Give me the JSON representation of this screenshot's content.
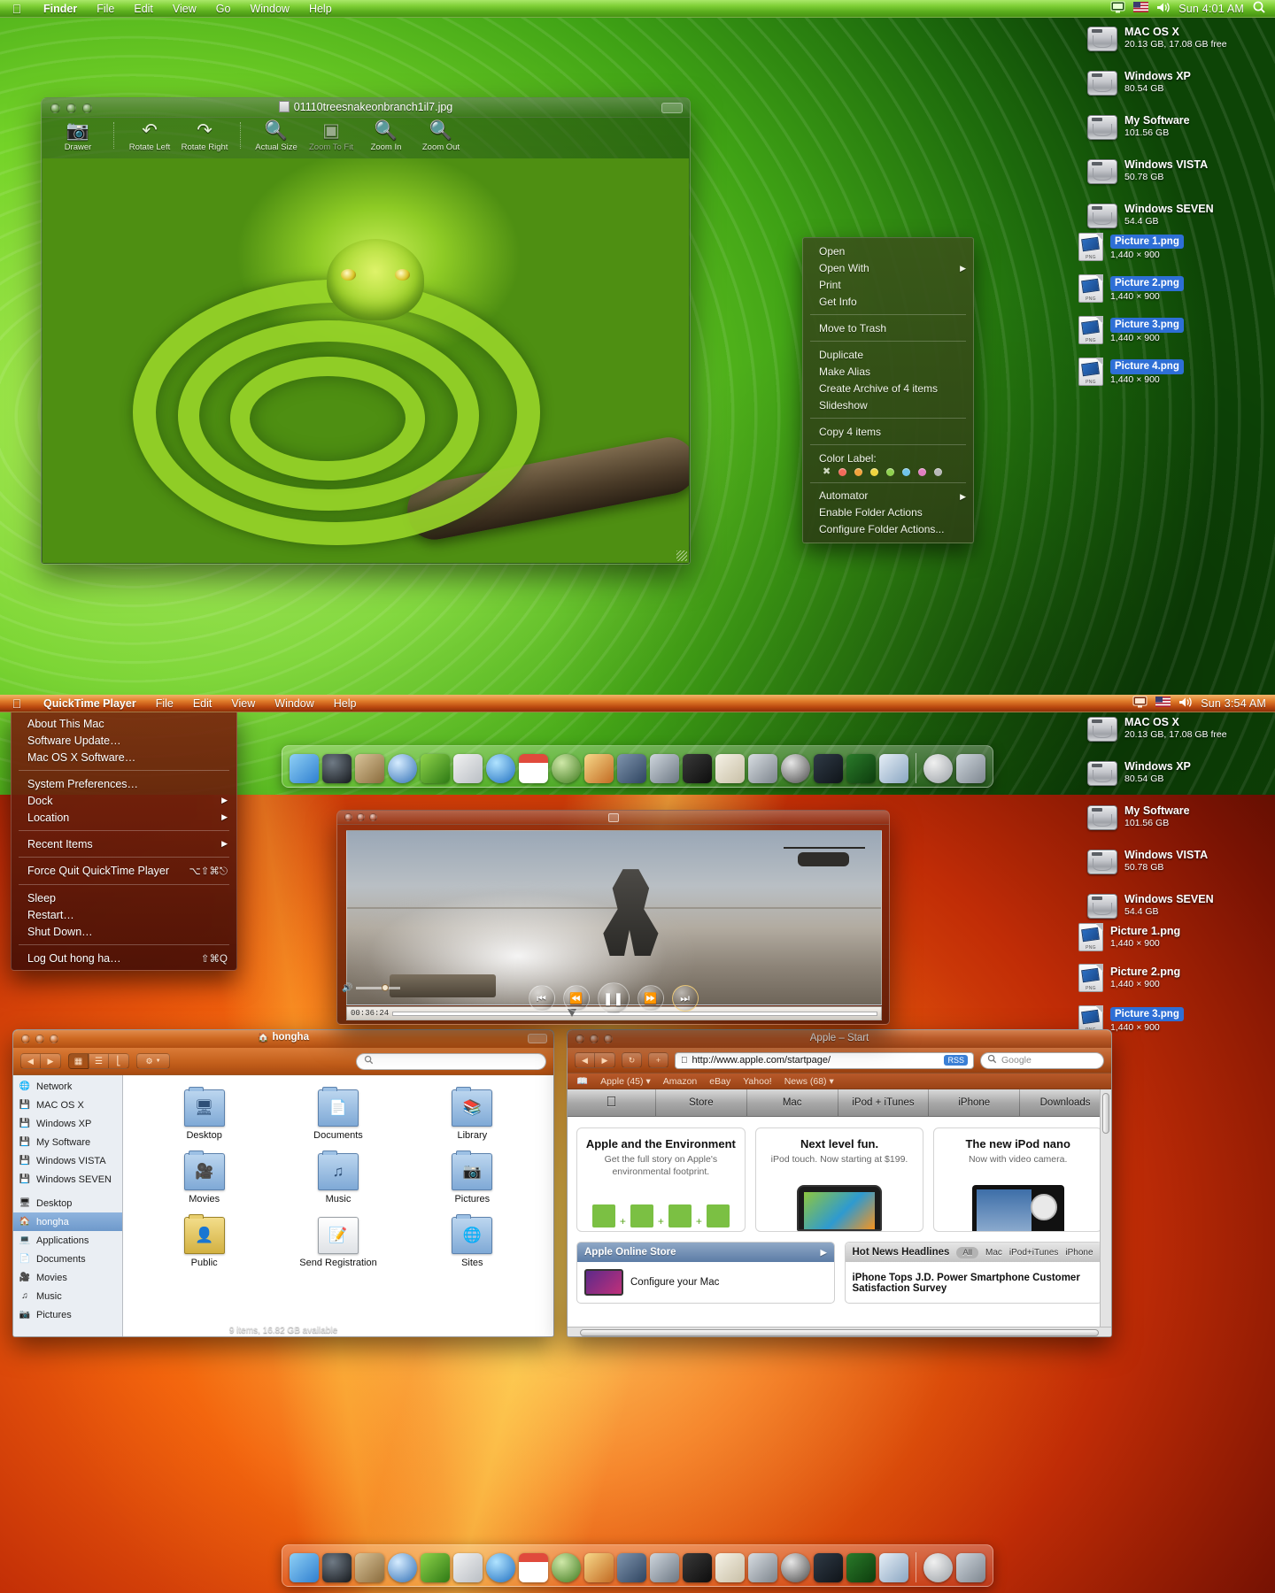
{
  "top_screen": {
    "menubar": {
      "apple_icon": "apple-logo",
      "items": [
        "Finder",
        "File",
        "Edit",
        "View",
        "Go",
        "Window",
        "Help"
      ],
      "active_app": "Finder",
      "extras": [
        "display-icon",
        "us-flag-icon",
        "volume-icon"
      ],
      "clock": "Sun 4:01 AM",
      "spotlight_icon": "magnifier-icon"
    },
    "desktop_drives": [
      {
        "name": "MAC OS X",
        "info": "20.13 GB, 17.08 GB free"
      },
      {
        "name": "Windows XP",
        "info": "80.54 GB"
      },
      {
        "name": "My Software",
        "info": "101.56 GB"
      },
      {
        "name": "Windows VISTA",
        "info": "50.78 GB"
      },
      {
        "name": "Windows SEVEN",
        "info": "54.4 GB"
      }
    ],
    "desktop_pictures": [
      {
        "name": "Picture 1.png",
        "info": "1,440 × 900"
      },
      {
        "name": "Picture 2.png",
        "info": "1,440 × 900"
      },
      {
        "name": "Picture 3.png",
        "info": "1,440 × 900"
      },
      {
        "name": "Picture 4.png",
        "info": "1,440 × 900"
      }
    ],
    "preview_window": {
      "title": "01110treesnakeonbranch1il7.jpg",
      "toolbar": [
        {
          "label": "Drawer",
          "icon": "drawer-icon",
          "enabled": true
        },
        {
          "label": "Rotate Left",
          "icon": "rotate-left-icon",
          "enabled": true
        },
        {
          "label": "Rotate Right",
          "icon": "rotate-right-icon",
          "enabled": true
        },
        {
          "label": "Actual Size",
          "icon": "magnifier-actual-icon",
          "enabled": true
        },
        {
          "label": "Zoom To Fit",
          "icon": "zoom-fit-icon",
          "enabled": false
        },
        {
          "label": "Zoom In",
          "icon": "zoom-in-icon",
          "enabled": true
        },
        {
          "label": "Zoom Out",
          "icon": "zoom-out-icon",
          "enabled": true
        }
      ]
    },
    "context_menu": {
      "groups": [
        [
          {
            "label": "Open"
          },
          {
            "label": "Open With",
            "submenu": true
          },
          {
            "label": "Print"
          },
          {
            "label": "Get Info"
          }
        ],
        [
          {
            "label": "Move to Trash"
          }
        ],
        [
          {
            "label": "Duplicate"
          },
          {
            "label": "Make Alias"
          },
          {
            "label": "Create Archive of 4 items"
          },
          {
            "label": "Slideshow"
          }
        ],
        [
          {
            "label": "Copy 4 items"
          }
        ]
      ],
      "color_label": "Color Label:",
      "swatch_colors": [
        "#f26a5a",
        "#f2a23c",
        "#efd53f",
        "#8fd14f",
        "#6fc3e8",
        "#e07ec0",
        "#b7b7b7"
      ],
      "tail": [
        {
          "label": "Automator",
          "submenu": true
        },
        {
          "label": "Enable Folder Actions"
        },
        {
          "label": "Configure Folder Actions..."
        }
      ]
    },
    "dock_icons": [
      "finder-icon",
      "dashboard-icon",
      "address-book-icon",
      "safari-icon",
      "ichat-icon",
      "mail-icon",
      "itunes-icon",
      "ical-icon",
      "time-machine-icon",
      "iphoto-icon",
      "spaces-icon",
      "automator-icon",
      "terminal-icon",
      "font-book-icon",
      "utilities-icon",
      "quicktime-icon",
      "dvd-player-icon",
      "activity-monitor-icon",
      "preview-icon",
      "at-symbol-icon",
      "trash-icon"
    ]
  },
  "bottom_screen": {
    "menubar": {
      "apple_icon": "apple-logo",
      "items": [
        "QuickTime Player",
        "File",
        "Edit",
        "View",
        "Window",
        "Help"
      ],
      "active_app": "QuickTime Player",
      "extras": [
        "display-icon",
        "us-flag-icon",
        "volume-icon"
      ],
      "clock": "Sun 3:54 AM"
    },
    "apple_menu": {
      "groups": [
        [
          {
            "label": "About This Mac"
          },
          {
            "label": "Software Update…"
          },
          {
            "label": "Mac OS X Software…"
          }
        ],
        [
          {
            "label": "System Preferences…"
          },
          {
            "label": "Dock",
            "submenu": true
          },
          {
            "label": "Location",
            "submenu": true
          }
        ],
        [
          {
            "label": "Recent Items",
            "submenu": true
          }
        ],
        [
          {
            "label": "Force Quit QuickTime Player",
            "shortcut": "⌥⇧⌘⎋"
          }
        ],
        [
          {
            "label": "Sleep"
          },
          {
            "label": "Restart…"
          },
          {
            "label": "Shut Down…"
          }
        ],
        [
          {
            "label": "Log Out hong ha…",
            "shortcut": "⇧⌘Q"
          }
        ]
      ]
    },
    "quicktime": {
      "current_time": "00:36:24",
      "controls": [
        "skip-back-icon",
        "rewind-icon",
        "pause-icon",
        "fast-forward-icon",
        "skip-forward-icon"
      ]
    },
    "desktop_drives": [
      {
        "name": "MAC OS X",
        "info": "20.13 GB, 17.08 GB free"
      },
      {
        "name": "Windows XP",
        "info": "80.54 GB"
      },
      {
        "name": "My Software",
        "info": "101.56 GB"
      },
      {
        "name": "Windows VISTA",
        "info": "50.78 GB"
      },
      {
        "name": "Windows SEVEN",
        "info": "54.4 GB"
      }
    ],
    "desktop_pictures": [
      {
        "name": "Picture 1.png",
        "info": "1,440 × 900"
      },
      {
        "name": "Picture 2.png",
        "info": "1,440 × 900"
      },
      {
        "name": "Picture 3.png",
        "info": "1,440 × 900"
      }
    ],
    "finder_window": {
      "title": "hongha",
      "title_icon": "home-icon",
      "search_placeholder": "",
      "search_icon": "search-icon",
      "nav_back_icon": "back-arrow-icon",
      "nav_forward_icon": "forward-arrow-icon",
      "view_icons": [
        "icon-view-icon",
        "list-view-icon",
        "column-view-icon"
      ],
      "action_icon": "gear-icon",
      "sidebar_devices": [
        "Network",
        "MAC OS X",
        "Windows XP",
        "My Software",
        "Windows VISTA",
        "Windows SEVEN"
      ],
      "sidebar_places": [
        "Desktop",
        "hongha",
        "Applications",
        "Documents",
        "Movies",
        "Music",
        "Pictures"
      ],
      "sidebar_selected": "hongha",
      "items": [
        {
          "name": "Desktop",
          "icon": "desktop-folder-icon"
        },
        {
          "name": "Documents",
          "icon": "documents-folder-icon"
        },
        {
          "name": "Library",
          "icon": "library-folder-icon"
        },
        {
          "name": "Movies",
          "icon": "movies-folder-icon"
        },
        {
          "name": "Music",
          "icon": "music-folder-icon"
        },
        {
          "name": "Pictures",
          "icon": "pictures-folder-icon"
        },
        {
          "name": "Public",
          "icon": "public-folder-icon"
        },
        {
          "name": "Send Registration",
          "icon": "registration-doc-icon"
        },
        {
          "name": "Sites",
          "icon": "sites-folder-icon"
        }
      ],
      "status": "9 items, 16.82 GB available"
    },
    "safari_window": {
      "title": "Apple – Start",
      "url": "http://www.apple.com/startpage/",
      "url_icon": "apple-favicon",
      "rss_badge": "RSS",
      "reload_icon": "reload-icon",
      "add_icon": "plus-icon",
      "search_placeholder": "Google",
      "search_icon": "google-search-icon",
      "bookmarks_icon": "book-icon",
      "bookmarks": [
        "Apple (45)",
        "Amazon",
        "eBay",
        "Yahoo!",
        "News (68)"
      ],
      "nav_tabs": [
        "Store",
        "Mac",
        "iPod + iTunes",
        "iPhone",
        "Downloads"
      ],
      "nav_logo": "apple-logo",
      "promos": [
        {
          "title": "Apple and the Environment",
          "subtitle": "Get the full story on Apple's environmental footprint.",
          "art": "environment"
        },
        {
          "title": "Next level fun.",
          "subtitle": "iPod touch. Now starting at $199.",
          "art": "ipod-touch"
        },
        {
          "title": "The new iPod nano",
          "subtitle": "Now with video camera.",
          "art": "ipod-nano"
        }
      ],
      "store_panel": {
        "header": "Apple Online Store",
        "item": "Configure your Mac"
      },
      "news_panel": {
        "header": "Hot News Headlines",
        "filters": [
          "All",
          "Mac",
          "iPod+iTunes",
          "iPhone"
        ],
        "active_filter": "All",
        "headline": "iPhone Tops J.D. Power Smartphone Customer Satisfaction Survey"
      }
    },
    "dock_icons": [
      "finder-icon",
      "dashboard-icon",
      "address-book-icon",
      "safari-icon",
      "ichat-icon",
      "mail-icon",
      "itunes-icon",
      "ical-icon",
      "time-machine-icon",
      "iphoto-icon",
      "spaces-icon",
      "automator-icon",
      "terminal-icon",
      "font-book-icon",
      "utilities-icon",
      "quicktime-icon",
      "dvd-player-icon",
      "activity-monitor-icon",
      "preview-icon",
      "at-symbol-icon",
      "trash-icon"
    ]
  }
}
